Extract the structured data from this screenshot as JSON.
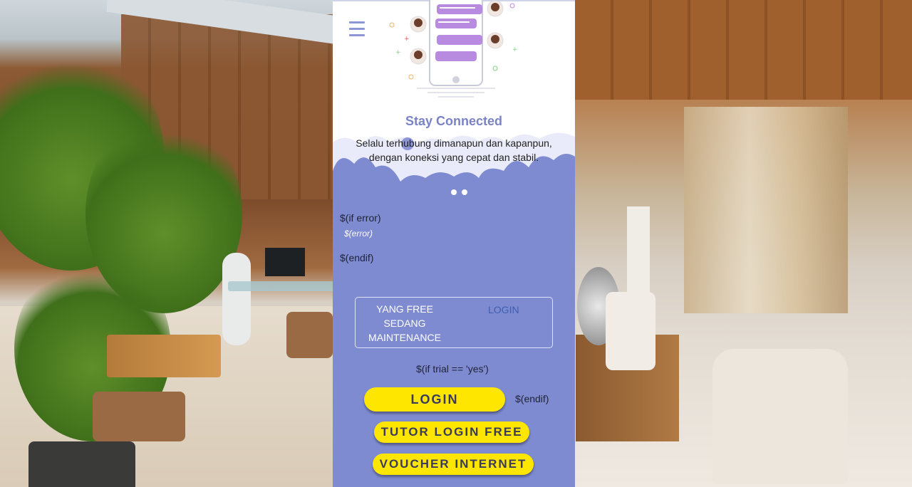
{
  "header": {
    "title": "Stay Connected",
    "subtitle_line1": "Selalu terhubung dimanapun dan kapanpun,",
    "subtitle_line2": "dengan koneksi yang cepat dan stabil."
  },
  "template": {
    "if_error": "$(if error)",
    "error": "$(error)",
    "endif_1": "$(endif)",
    "if_trial": "$(if trial == 'yes')",
    "endif_2": "$(endif)"
  },
  "notice": {
    "line1": "YANG FREE",
    "line2": "SEDANG",
    "line3": "MAINTENANCE",
    "link_label": "LOGIN"
  },
  "buttons": {
    "login": "LOGIN",
    "tutor": "TUTOR LOGIN FREE",
    "voucher": "VOUCHER INTERNET"
  },
  "colors": {
    "panel": "#7e8bd0",
    "button": "#ffe600",
    "title": "#7b83c7"
  },
  "icons": [
    "menu-icon",
    "chat-illustration"
  ],
  "carousel": {
    "slides": 2
  }
}
